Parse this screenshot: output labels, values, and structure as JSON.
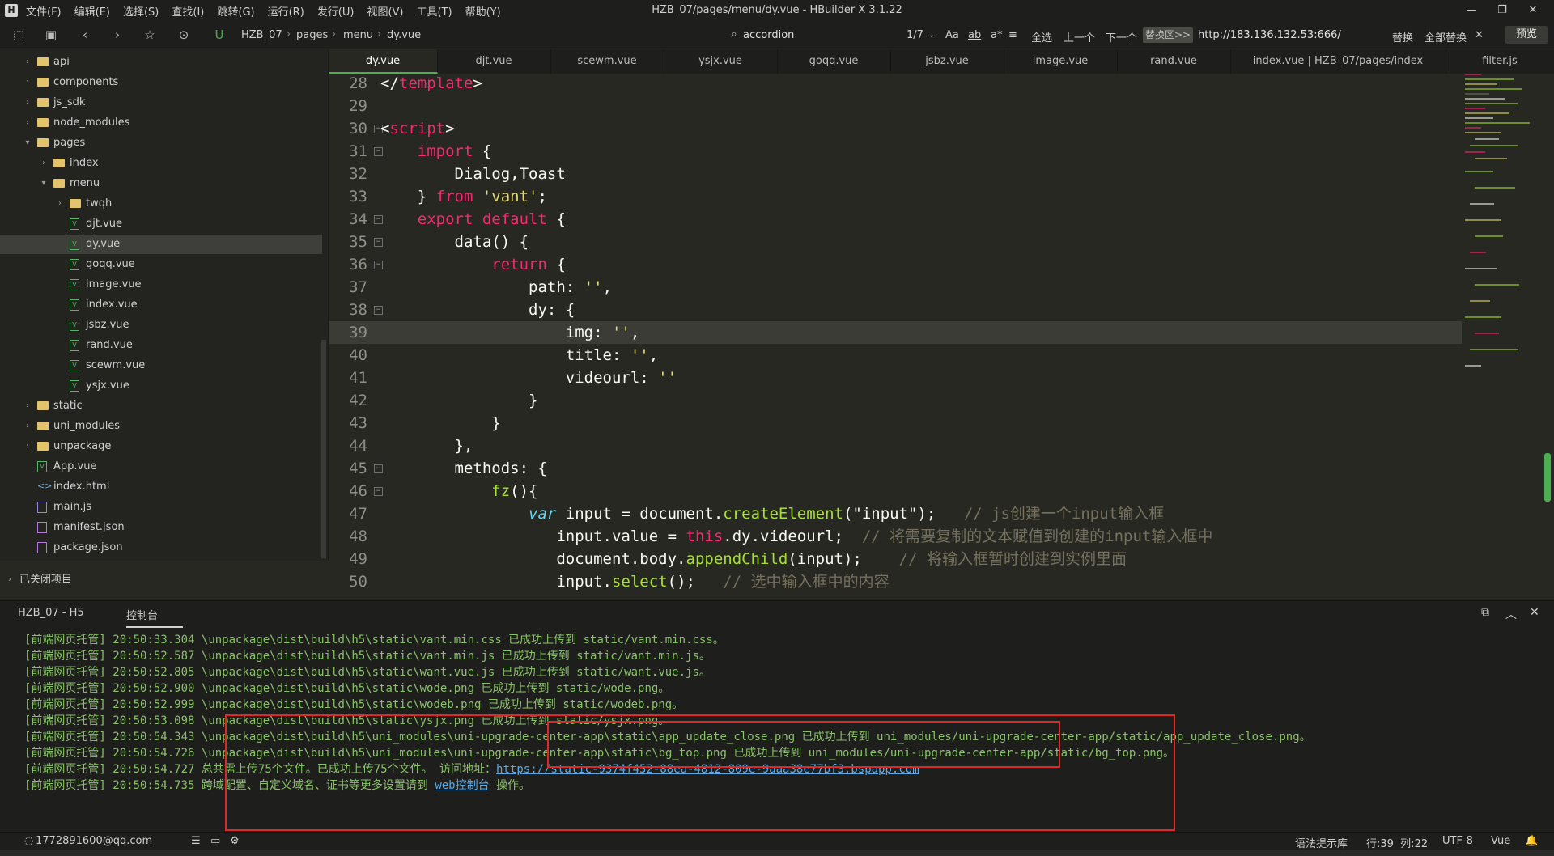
{
  "window": {
    "title": "HZB_07/pages/menu/dy.vue - HBuilder X 3.1.22",
    "app_icon_letter": "H",
    "menu": [
      "文件(F)",
      "编辑(E)",
      "选择(S)",
      "查找(I)",
      "跳转(G)",
      "运行(R)",
      "发行(U)",
      "视图(V)",
      "工具(T)",
      "帮助(Y)"
    ]
  },
  "toolbar": {
    "breadcrumb": [
      "HZB_07",
      "pages",
      "menu",
      "dy.vue"
    ],
    "search_value": "accordion",
    "match_count": "1/7",
    "find_opts": [
      "Aa",
      "ab",
      "a*"
    ],
    "select_all": "全选",
    "prev": "上一个",
    "next": "下一个",
    "replace_toggle": "替换区>>",
    "replace_value": "http://183.136.132.53:666/",
    "replace": "替换",
    "replace_all": "全部替换",
    "close": "✕",
    "preview": "预览"
  },
  "sidebar": {
    "items": [
      {
        "label": "api",
        "type": "folder"
      },
      {
        "label": "components",
        "type": "folder"
      },
      {
        "label": "js_sdk",
        "type": "folder"
      },
      {
        "label": "node_modules",
        "type": "folder"
      },
      {
        "label": "pages",
        "type": "folder-open"
      },
      {
        "label": "index",
        "type": "folder"
      },
      {
        "label": "menu",
        "type": "folder-open"
      },
      {
        "label": "twqh",
        "type": "folder"
      },
      {
        "label": "djt.vue",
        "type": "vue"
      },
      {
        "label": "dy.vue",
        "type": "vue",
        "selected": true
      },
      {
        "label": "goqq.vue",
        "type": "vue"
      },
      {
        "label": "image.vue",
        "type": "vue"
      },
      {
        "label": "index.vue",
        "type": "vue"
      },
      {
        "label": "jsbz.vue",
        "type": "vue"
      },
      {
        "label": "rand.vue",
        "type": "vue"
      },
      {
        "label": "scewm.vue",
        "type": "vue"
      },
      {
        "label": "ysjx.vue",
        "type": "vue"
      },
      {
        "label": "static",
        "type": "folder"
      },
      {
        "label": "uni_modules",
        "type": "folder"
      },
      {
        "label": "unpackage",
        "type": "folder"
      },
      {
        "label": "App.vue",
        "type": "vue"
      },
      {
        "label": "index.html",
        "type": "html"
      },
      {
        "label": "main.js",
        "type": "js"
      },
      {
        "label": "manifest.json",
        "type": "json"
      },
      {
        "label": "package.json",
        "type": "json"
      }
    ],
    "closed_projects": "已关闭项目"
  },
  "tabs": [
    "dy.vue",
    "djt.vue",
    "scewm.vue",
    "ysjx.vue",
    "goqq.vue",
    "jsbz.vue",
    "image.vue",
    "rand.vue",
    "index.vue | HZB_07/pages/index",
    "filter.js"
  ],
  "editor": {
    "lines": [
      {
        "n": "28",
        "fold": false,
        "segs": [
          [
            "tk-plain",
            "</"
          ],
          [
            "tk-tag",
            "template"
          ],
          [
            "tk-plain",
            ">"
          ]
        ]
      },
      {
        "n": "29",
        "fold": false,
        "segs": []
      },
      {
        "n": "30",
        "fold": true,
        "segs": [
          [
            "tk-plain",
            "<"
          ],
          [
            "tk-tag",
            "script"
          ],
          [
            "tk-plain",
            ">"
          ]
        ]
      },
      {
        "n": "31",
        "fold": true,
        "segs": [
          [
            "tk-plain",
            "    "
          ],
          [
            "tk-kw",
            "import"
          ],
          [
            "tk-plain",
            " {"
          ]
        ]
      },
      {
        "n": "32",
        "fold": false,
        "segs": [
          [
            "tk-plain",
            "        Dialog,Toast"
          ]
        ]
      },
      {
        "n": "33",
        "fold": false,
        "segs": [
          [
            "tk-plain",
            "    } "
          ],
          [
            "tk-kw",
            "from"
          ],
          [
            "tk-plain",
            " "
          ],
          [
            "tk-str",
            "'vant'"
          ],
          [
            "tk-plain",
            ";"
          ]
        ]
      },
      {
        "n": "34",
        "fold": true,
        "segs": [
          [
            "tk-plain",
            "    "
          ],
          [
            "tk-kw",
            "export"
          ],
          [
            "tk-plain",
            " "
          ],
          [
            "tk-kw",
            "default"
          ],
          [
            "tk-plain",
            " {"
          ]
        ]
      },
      {
        "n": "35",
        "fold": true,
        "segs": [
          [
            "tk-plain",
            "        data() {"
          ]
        ]
      },
      {
        "n": "36",
        "fold": true,
        "segs": [
          [
            "tk-plain",
            "            "
          ],
          [
            "tk-kw",
            "return"
          ],
          [
            "tk-plain",
            " {"
          ]
        ]
      },
      {
        "n": "37",
        "fold": false,
        "segs": [
          [
            "tk-plain",
            "                path: "
          ],
          [
            "tk-str",
            "''"
          ],
          [
            "tk-plain",
            ","
          ]
        ]
      },
      {
        "n": "38",
        "fold": true,
        "segs": [
          [
            "tk-plain",
            "                dy: {"
          ]
        ]
      },
      {
        "n": "39",
        "fold": false,
        "current": true,
        "segs": [
          [
            "tk-plain",
            "                    img: "
          ],
          [
            "tk-str",
            "''"
          ],
          [
            "tk-plain",
            ","
          ]
        ]
      },
      {
        "n": "40",
        "fold": false,
        "segs": [
          [
            "tk-plain",
            "                    title: "
          ],
          [
            "tk-str",
            "''"
          ],
          [
            "tk-plain",
            ","
          ]
        ]
      },
      {
        "n": "41",
        "fold": false,
        "segs": [
          [
            "tk-plain",
            "                    videourl: "
          ],
          [
            "tk-str",
            "''"
          ]
        ]
      },
      {
        "n": "42",
        "fold": false,
        "segs": [
          [
            "tk-plain",
            "                }"
          ]
        ]
      },
      {
        "n": "43",
        "fold": false,
        "segs": [
          [
            "tk-plain",
            "            }"
          ]
        ]
      },
      {
        "n": "44",
        "fold": false,
        "segs": [
          [
            "tk-plain",
            "        },"
          ]
        ]
      },
      {
        "n": "45",
        "fold": true,
        "segs": [
          [
            "tk-plain",
            "        methods: {"
          ]
        ]
      },
      {
        "n": "46",
        "fold": true,
        "segs": [
          [
            "tk-plain",
            "            "
          ],
          [
            "tk-fn",
            "fz"
          ],
          [
            "tk-plain",
            "(){"
          ]
        ]
      },
      {
        "n": "47",
        "fold": false,
        "segs": [
          [
            "tk-plain",
            "                "
          ],
          [
            "tk-var",
            "var"
          ],
          [
            "tk-plain",
            " input = document."
          ],
          [
            "tk-fn",
            "createElement"
          ],
          [
            "tk-plain",
            "(\"input\");   "
          ],
          [
            "tk-cmt",
            "// js创建一个input输入框"
          ]
        ]
      },
      {
        "n": "48",
        "fold": false,
        "segs": [
          [
            "tk-plain",
            "                   input.value = "
          ],
          [
            "tk-this",
            "this"
          ],
          [
            "tk-plain",
            ".dy.videourl;  "
          ],
          [
            "tk-cmt",
            "// 将需要复制的文本赋值到创建的input输入框中"
          ]
        ]
      },
      {
        "n": "49",
        "fold": false,
        "segs": [
          [
            "tk-plain",
            "                   document.body."
          ],
          [
            "tk-fn",
            "appendChild"
          ],
          [
            "tk-plain",
            "(input);    "
          ],
          [
            "tk-cmt",
            "// 将输入框暂时创建到实例里面"
          ]
        ]
      },
      {
        "n": "50",
        "fold": false,
        "segs": [
          [
            "tk-plain",
            "                   input."
          ],
          [
            "tk-fn",
            "select"
          ],
          [
            "tk-plain",
            "();   "
          ],
          [
            "tk-cmt",
            "// 选中输入框中的内容"
          ]
        ]
      }
    ]
  },
  "console": {
    "tabs": [
      "HZB_07 - H5",
      "控制台"
    ],
    "icons": [
      "open-external-icon",
      "collapse-icon",
      "close-all-icon"
    ],
    "icon_glyphs": [
      "⧉",
      "︿",
      "✕"
    ],
    "lines": [
      {
        "prefix": "[前端网页托管]",
        "time": "20:50:33.304",
        "text": "\\unpackage\\dist\\build\\h5\\static\\vant.min.css 已成功上传到 static/vant.min.css。"
      },
      {
        "prefix": "[前端网页托管]",
        "time": "20:50:52.587",
        "text": "\\unpackage\\dist\\build\\h5\\static\\vant.min.js 已成功上传到 static/vant.min.js。"
      },
      {
        "prefix": "[前端网页托管]",
        "time": "20:50:52.805",
        "text": "\\unpackage\\dist\\build\\h5\\static\\want.vue.js 已成功上传到 static/want.vue.js。"
      },
      {
        "prefix": "[前端网页托管]",
        "time": "20:50:52.900",
        "text": "\\unpackage\\dist\\build\\h5\\static\\wode.png 已成功上传到 static/wode.png。"
      },
      {
        "prefix": "[前端网页托管]",
        "time": "20:50:52.999",
        "text": "\\unpackage\\dist\\build\\h5\\static\\wodeb.png 已成功上传到 static/wodeb.png。"
      },
      {
        "prefix": "[前端网页托管]",
        "time": "20:50:53.098",
        "text": "\\unpackage\\dist\\build\\h5\\static\\ysjx.png 已成功上传到 static/ysjx.png。"
      },
      {
        "prefix": "[前端网页托管]",
        "time": "20:50:54.343",
        "text": "\\unpackage\\dist\\build\\h5\\uni_modules\\uni-upgrade-center-app\\static\\app_update_close.png 已成功上传到 uni_modules/uni-upgrade-center-app/static/app_update_close.png。"
      },
      {
        "prefix": "[前端网页托管]",
        "time": "20:50:54.726",
        "text": "\\unpackage\\dist\\build\\h5\\uni_modules\\uni-upgrade-center-app\\static\\bg_top.png 已成功上传到 uni_modules/uni-upgrade-center-app/static/bg_top.png。"
      },
      {
        "prefix": "[前端网页托管]",
        "time": "20:50:54.727",
        "text": "总共需上传75个文件。已成功上传75个文件。  访问地址：",
        "link": "https://static-9374f452-88ea-4812-809e-9aaa38e77bf3.bspapp.com"
      },
      {
        "prefix": "[前端网页托管]",
        "time": "20:50:54.735",
        "text": "跨域配置、自定义域名、证书等更多设置请到 ",
        "link": "web控制台",
        "suffix": " 操作。"
      }
    ]
  },
  "status": {
    "user": "1772891600@qq.com",
    "hint_lib": "语法提示库",
    "position": "行:39  列:22",
    "encoding": "UTF-8",
    "language": "Vue"
  },
  "colors": {
    "background": "#272822",
    "accent": "#4caf50",
    "highlight_box": "#e02828"
  }
}
